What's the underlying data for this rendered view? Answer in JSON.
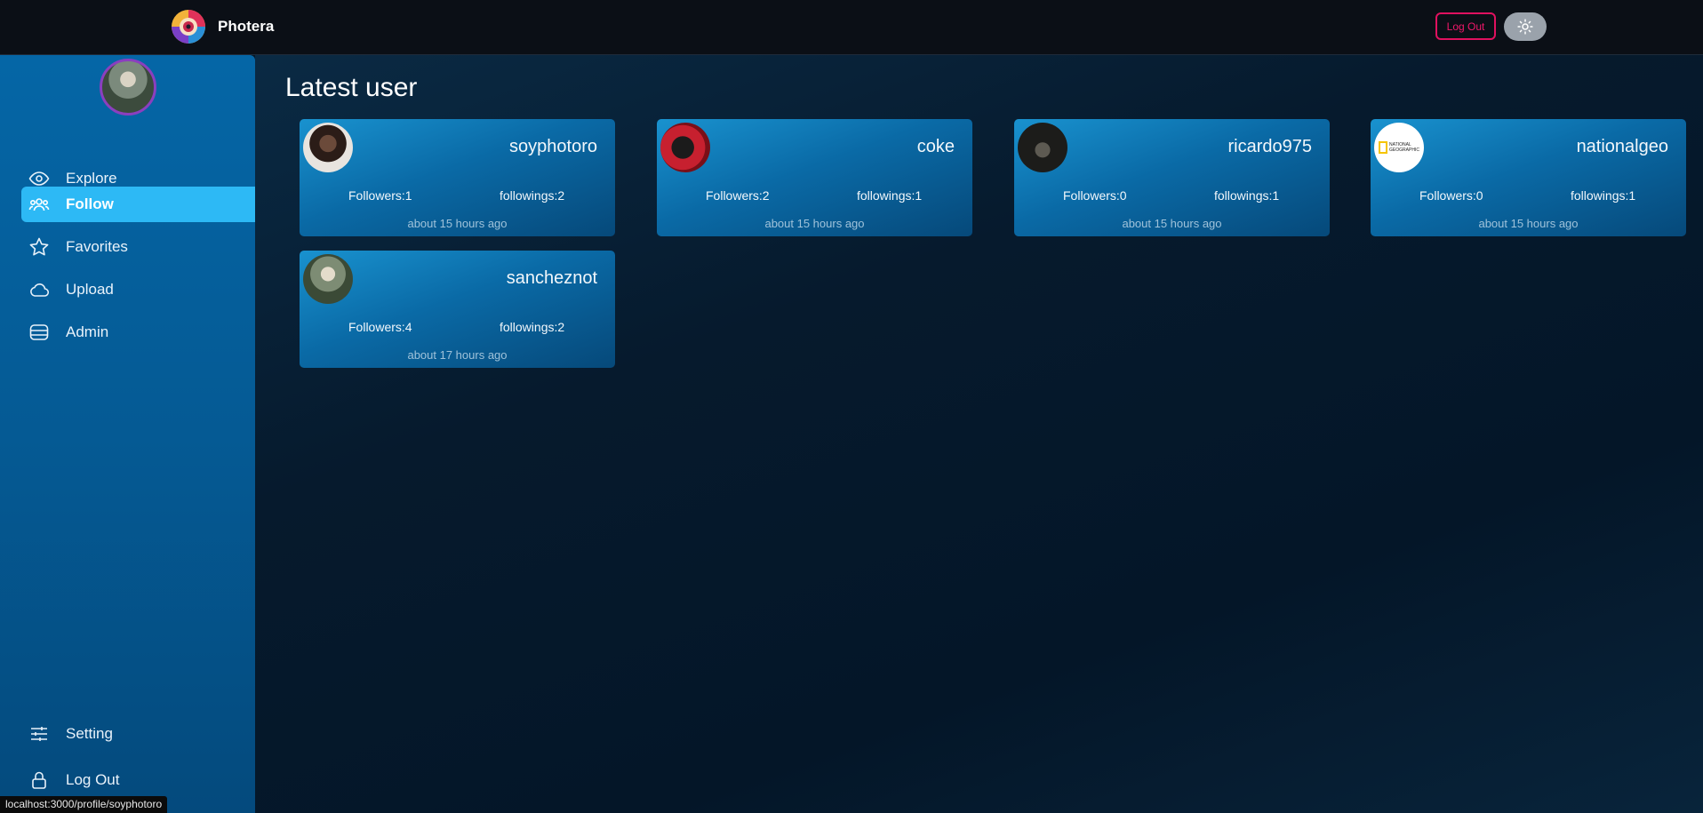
{
  "app": {
    "name": "Photera"
  },
  "header": {
    "logout_label": "Log Out",
    "theme_icon": "sun-icon"
  },
  "sidebar": {
    "items": [
      {
        "label": "Explore",
        "icon": "eye-icon"
      },
      {
        "label": "Follow",
        "icon": "users-icon"
      },
      {
        "label": "Favorites",
        "icon": "star-icon"
      },
      {
        "label": "Upload",
        "icon": "cloud-icon"
      },
      {
        "label": "Admin",
        "icon": "database-icon"
      }
    ],
    "bottom_items": [
      {
        "label": "Setting",
        "icon": "sliders-icon"
      },
      {
        "label": "Log Out",
        "icon": "lock-icon"
      }
    ]
  },
  "main": {
    "title": "Latest user",
    "users": [
      {
        "username": "soyphotoro",
        "followers": "Followers:1",
        "followings": "followings:2",
        "time": "about 15 hours ago"
      },
      {
        "username": "coke",
        "followers": "Followers:2",
        "followings": "followings:1",
        "time": "about 15 hours ago"
      },
      {
        "username": "ricardo975",
        "followers": "Followers:0",
        "followings": "followings:1",
        "time": "about 15 hours ago"
      },
      {
        "username": "nationalgeo",
        "followers": "Followers:0",
        "followings": "followings:1",
        "time": "about 15 hours ago"
      },
      {
        "username": "sancheznot",
        "followers": "Followers:4",
        "followings": "followings:2",
        "time": "about 17 hours ago"
      }
    ]
  },
  "status_bar": {
    "url": "localhost:3000/profile/soyphotoro"
  },
  "colors": {
    "accent": "#2db9f5",
    "logout_border": "#e0115f",
    "sidebar": "#0566a6"
  }
}
